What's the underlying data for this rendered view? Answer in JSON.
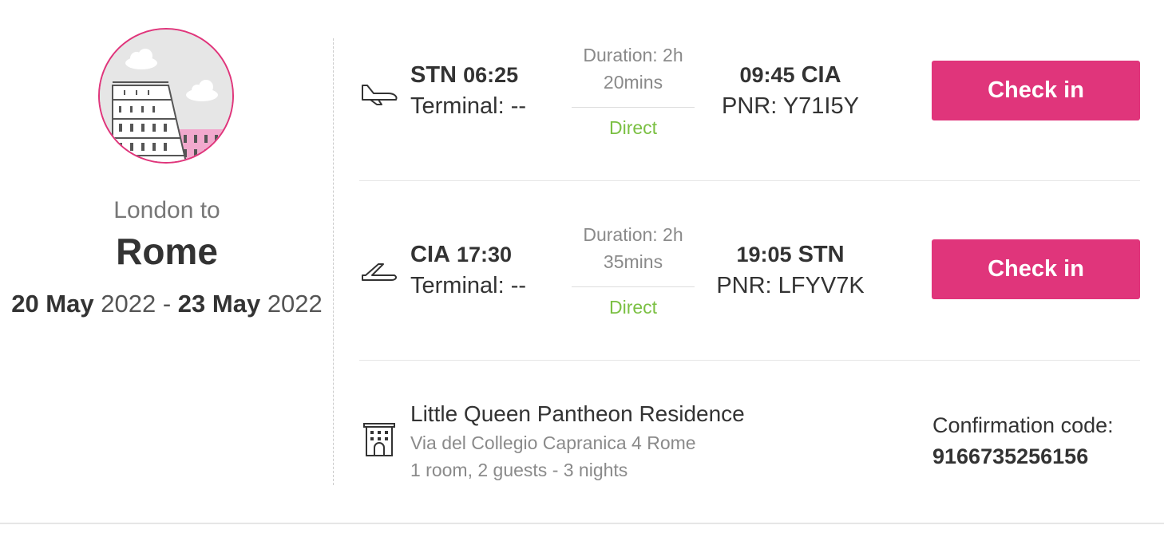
{
  "trip": {
    "from_label": "London to",
    "destination": "Rome",
    "dates": {
      "start_day": "20 May",
      "start_year": "2022",
      "separator": "-",
      "end_day": "23 May",
      "end_year": "2022"
    },
    "badge_icon": "colosseum-illustration"
  },
  "flights": [
    {
      "direction_icon": "plane-departure-icon",
      "dep_code": "STN",
      "dep_time": "06:25",
      "dep_terminal": "Terminal: --",
      "duration": "Duration: 2h 20mins",
      "stops": "Direct",
      "arr_time": "09:45",
      "arr_code": "CIA",
      "pnr": "PNR: Y71I5Y",
      "button_label": "Check in"
    },
    {
      "direction_icon": "plane-arrival-icon",
      "dep_code": "CIA",
      "dep_time": "17:30",
      "dep_terminal": "Terminal: --",
      "duration": "Duration: 2h 35mins",
      "stops": "Direct",
      "arr_time": "19:05",
      "arr_code": "STN",
      "pnr": "PNR: LFYV7K",
      "button_label": "Check in"
    }
  ],
  "hotel": {
    "icon": "hotel-icon",
    "name": "Little Queen Pantheon Residence",
    "address": "Via del Collegio Capranica 4 Rome",
    "details": "1 room, 2 guests - 3 nights",
    "confirmation_label": "Confirmation code:",
    "confirmation_code": "9166735256156"
  },
  "colors": {
    "accent": "#e0357b",
    "direct": "#7bc043",
    "muted_text": "#8a8a8a"
  }
}
